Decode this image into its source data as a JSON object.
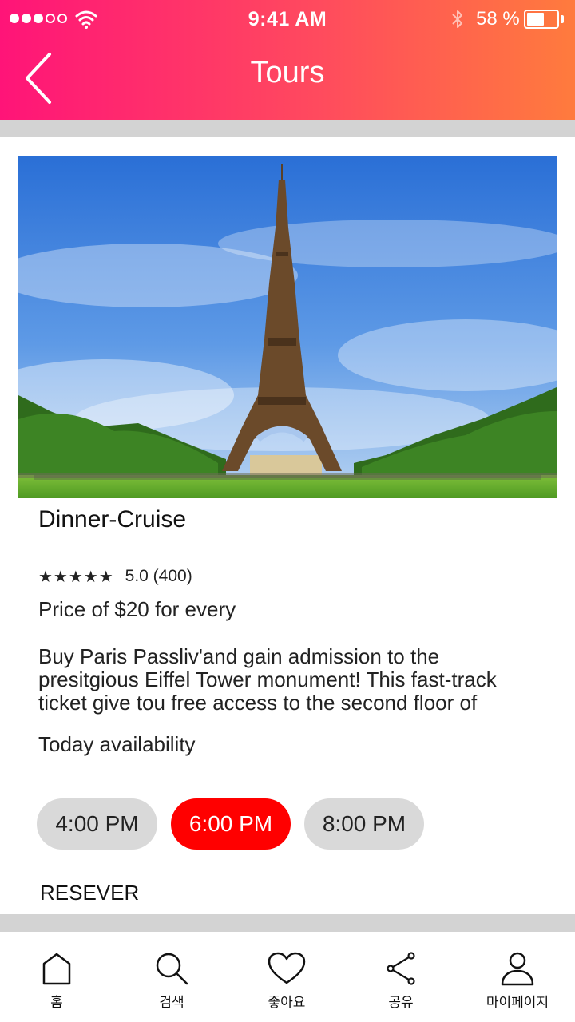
{
  "status_bar": {
    "time": "9:41 AM",
    "battery_percent": "58 %",
    "battery_level": 0.58,
    "signal_bars_filled": 3,
    "signal_bars_total": 5
  },
  "header": {
    "title": "Tours",
    "back_icon": "chevron-left-icon",
    "gradient_colors": [
      "#ff1478",
      "#ff7b3d"
    ]
  },
  "tour": {
    "image_icon": "eiffel-tower-photo",
    "name": "Dinner-Cruise",
    "stars": "★★★★★",
    "rating": "5.0 (400)",
    "price": "Price of $20 for every",
    "description": [
      "Buy Paris Passliv'and gain admission to the",
      "presitgious Eiffel Tower monument! This fast-track",
      "ticket give tou free access to the second floor of"
    ],
    "availability_label": "Today availability"
  },
  "time_slots": [
    {
      "label": "4:00 PM",
      "selected": false
    },
    {
      "label": "6:00 PM",
      "selected": true
    },
    {
      "label": "8:00 PM",
      "selected": false
    }
  ],
  "reserve_label": "RESEVER",
  "colors": {
    "accent_selected": "#ff0000",
    "slot_default": "#d9d9d9",
    "separator": "#d3d3d3"
  },
  "tabbar": {
    "items": [
      {
        "label": "홈",
        "icon": "home-icon"
      },
      {
        "label": "검색",
        "icon": "search-icon"
      },
      {
        "label": "좋아요",
        "icon": "heart-icon"
      },
      {
        "label": "공유",
        "icon": "share-icon"
      },
      {
        "label": "마이페이지",
        "icon": "user-icon"
      }
    ]
  }
}
